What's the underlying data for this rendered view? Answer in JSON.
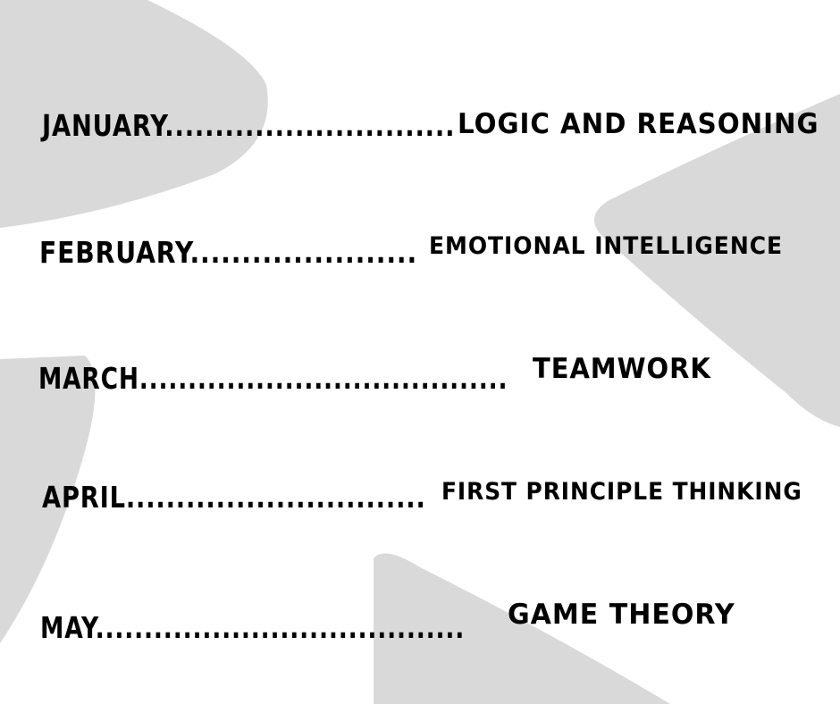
{
  "colors": {
    "background": "#ffffff",
    "shape": "#d9d9d9",
    "text": "#000000"
  },
  "schedule": [
    {
      "month": "JANUARY.............................",
      "topic": "LOGIC AND REASONING"
    },
    {
      "month": "FEBRUARY......................",
      "topic": "EMOTIONAL INTELLIGENCE"
    },
    {
      "month": "MARCH......................................",
      "topic": "TEAMWORK"
    },
    {
      "month": "APRIL..............................",
      "topic": "FIRST PRINCIPLE THINKING"
    },
    {
      "month": "MAY......................................",
      "topic": "GAME THEORY"
    }
  ]
}
